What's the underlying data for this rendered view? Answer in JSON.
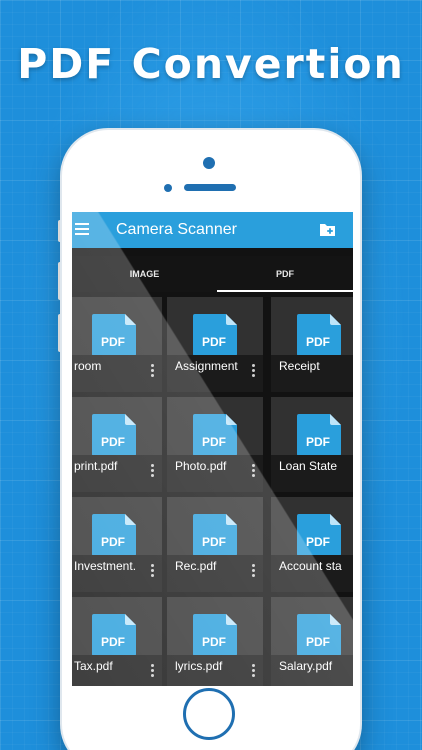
{
  "promo": {
    "headline": "PDF Convertion"
  },
  "app": {
    "title": "Camera Scanner",
    "menu_icon": "hamburger-menu-icon",
    "action_icon": "add-folder-icon",
    "accent_color": "#2a9fdc"
  },
  "tabs": [
    {
      "label": "IMAGE",
      "selected": false
    },
    {
      "label": "PDF",
      "selected": true
    }
  ],
  "files": [
    {
      "name": "room"
    },
    {
      "name": "Assignment"
    },
    {
      "name": "Receipt"
    },
    {
      "name": "print.pdf"
    },
    {
      "name": "Photo.pdf"
    },
    {
      "name": "Loan State"
    },
    {
      "name": "Investment."
    },
    {
      "name": "Rec.pdf"
    },
    {
      "name": "Account sta"
    },
    {
      "name": "Tax.pdf"
    },
    {
      "name": "lyrics.pdf"
    },
    {
      "name": "Salary.pdf"
    }
  ],
  "file_icon": {
    "name": "pdf-file-icon",
    "text": "PDF",
    "color": "#2a9fdc"
  },
  "colors": {
    "background": "#1e8fdb",
    "phone": "#ffffff",
    "phone_accent": "#1f6fb1"
  }
}
